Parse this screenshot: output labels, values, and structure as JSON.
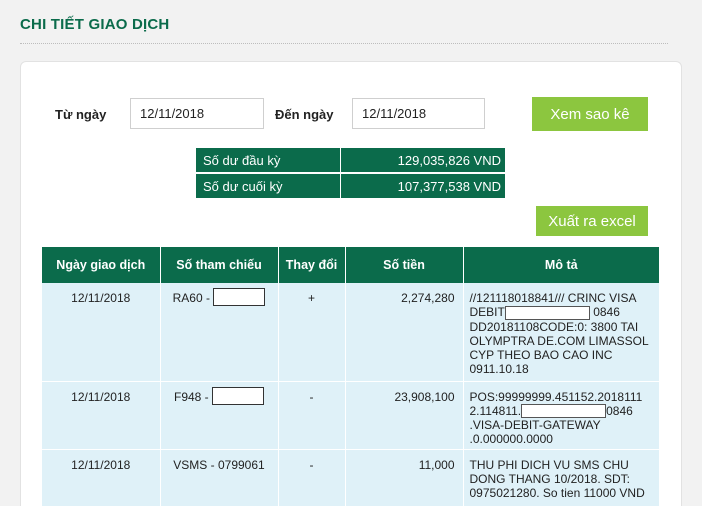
{
  "page": {
    "title": "CHI TIẾT GIAO DỊCH"
  },
  "filter": {
    "from_label": "Từ ngày",
    "from_value": "12/11/2018",
    "to_label": "Đến ngày",
    "to_value": "12/11/2018",
    "view_button": "Xem sao kê"
  },
  "balances": {
    "opening_label": "Số dư đầu kỳ",
    "opening_value": "129,035,826 VND",
    "closing_label": "Số dư cuối kỳ",
    "closing_value": "107,377,538 VND"
  },
  "export_button": "Xuất ra excel",
  "table": {
    "headers": [
      "Ngày giao dịch",
      "Số tham chiếu",
      "Thay đổi",
      "Số tiền",
      "Mô tả"
    ],
    "rows": [
      {
        "date": "12/11/2018",
        "ref": "RA60 -",
        "change": "+",
        "amount": "2,274,280",
        "desc_lines": [
          "//121118018841/// CRINC VISA",
          "DEBIT",
          "0846",
          "DD20181108CODE:0: 3800 TAI",
          "OLYMPTRA DE.COM LIMASSOL",
          "CYP THEO BAO CAO INC",
          "0911.10.18"
        ]
      },
      {
        "date": "12/11/2018",
        "ref": "F948 -",
        "change": "-",
        "amount": "23,908,100",
        "desc_lines": [
          "POS:99999999.451152.2018111",
          "2.114811.",
          "0846",
          ".VISA-DEBIT-GATEWAY",
          ".0.000000.0000"
        ]
      },
      {
        "date": "12/11/2018",
        "ref": "VSMS - 0799061",
        "change": "-",
        "amount": "11,000",
        "desc_lines": [
          "THU PHI DICH VU SMS CHU",
          "DONG THANG 10/2018. SDT:",
          "0975021280. So tien 11000 VND"
        ]
      }
    ]
  }
}
